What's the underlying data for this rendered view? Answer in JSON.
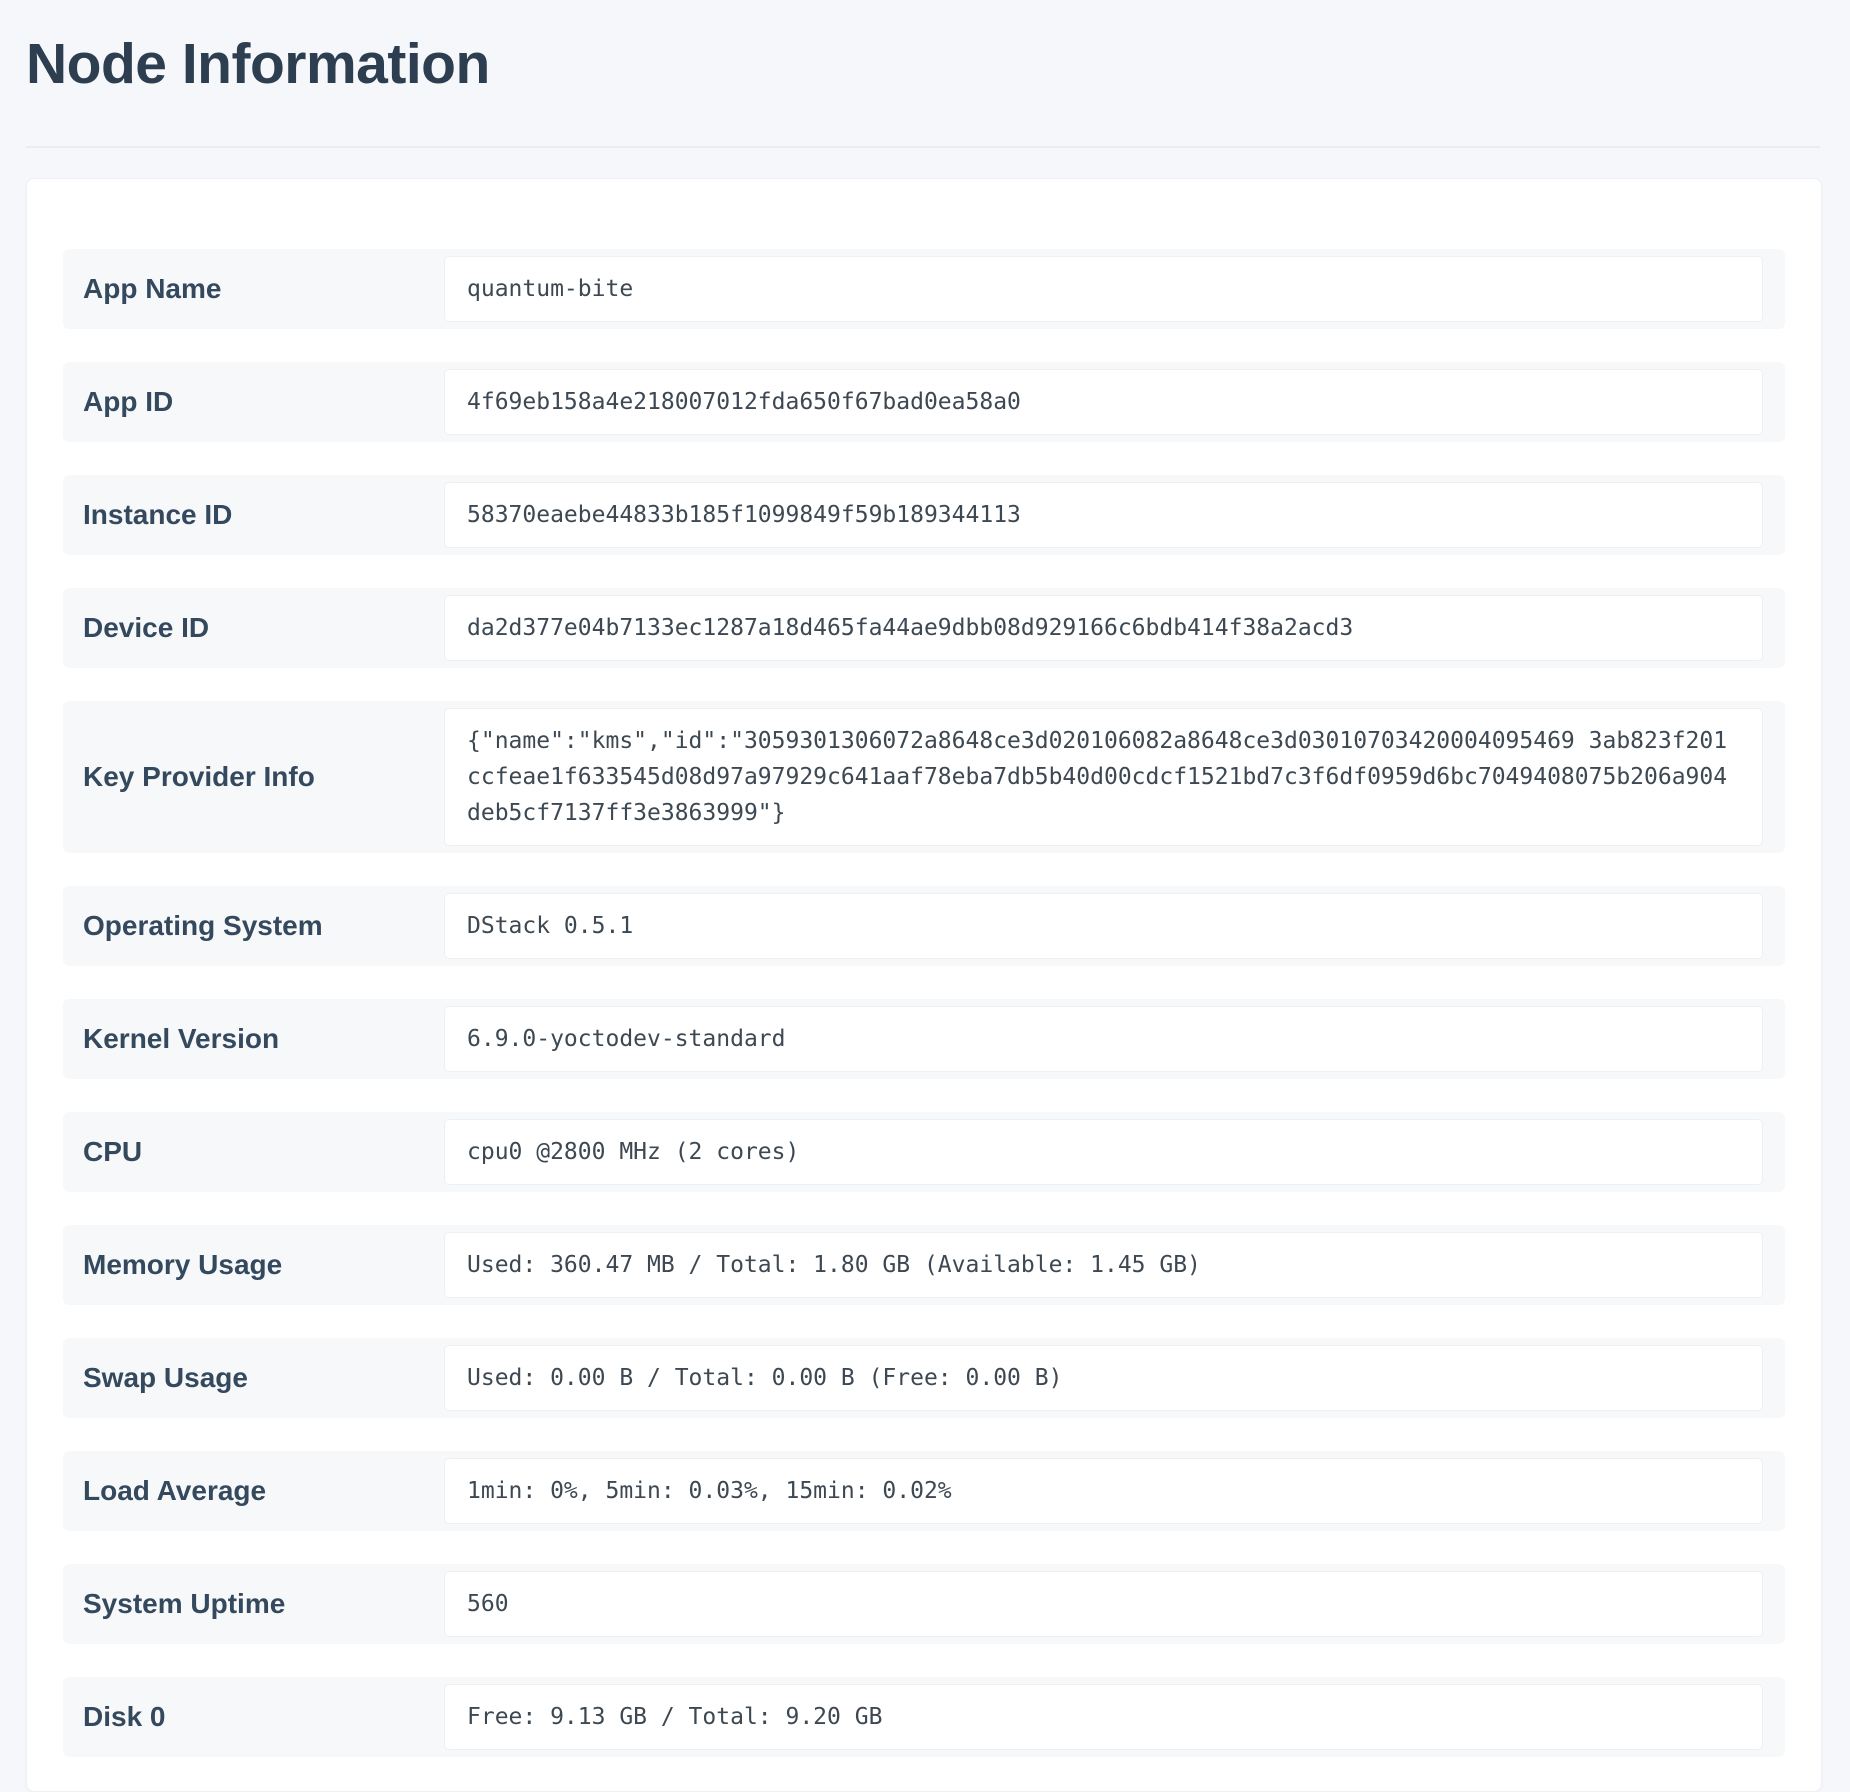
{
  "page": {
    "title": "Node Information"
  },
  "rows": [
    {
      "label": "App Name",
      "value": "quantum-bite"
    },
    {
      "label": "App ID",
      "value": "4f69eb158a4e218007012fda650f67bad0ea58a0"
    },
    {
      "label": "Instance ID",
      "value": "58370eaebe44833b185f1099849f59b189344113"
    },
    {
      "label": "Device ID",
      "value": "da2d377e04b7133ec1287a18d465fa44ae9dbb08d929166c6bdb414f38a2acd3"
    },
    {
      "label": "Key Provider Info",
      "value": "{\"name\":\"kms\",\"id\":\"3059301306072a8648ce3d020106082a8648ce3d03010703420004095469 3ab823f201ccfeae1f633545d08d97a97929c641aaf78eba7db5b40d00cdcf1521bd7c3f6df0959d6bc7049408075b206a904deb5cf7137ff3e3863999\"}"
    },
    {
      "label": "Operating System",
      "value": "DStack 0.5.1"
    },
    {
      "label": "Kernel Version",
      "value": "6.9.0-yoctodev-standard"
    },
    {
      "label": "CPU",
      "value": "cpu0 @2800 MHz (2 cores)"
    },
    {
      "label": "Memory Usage",
      "value": "Used: 360.47 MB / Total: 1.80 GB (Available: 1.45 GB)"
    },
    {
      "label": "Swap Usage",
      "value": "Used: 0.00 B / Total: 0.00 B (Free: 0.00 B)"
    },
    {
      "label": "Load Average",
      "value": "1min: 0%, 5min: 0.03%, 15min: 0.02%"
    },
    {
      "label": "System Uptime",
      "value": "560"
    },
    {
      "label": "Disk 0",
      "value": "Free: 9.13 GB / Total: 9.20 GB"
    }
  ]
}
